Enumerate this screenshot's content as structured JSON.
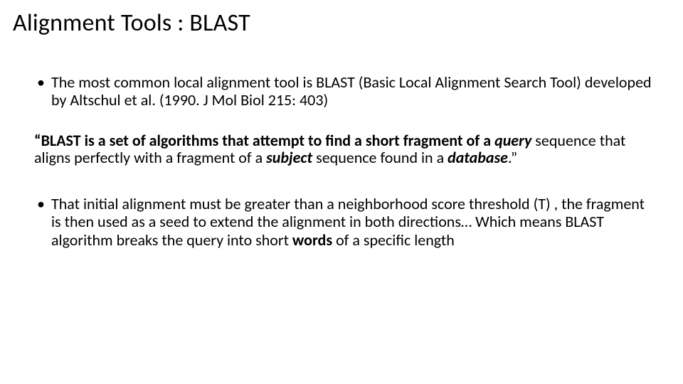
{
  "title": "Alignment Tools : BLAST",
  "p1": {
    "a": "The most common local alignment tool is BLAST (Basic Local Alignment Search Tool) developed by Altschul et al. (1990. J Mol Biol 215: 403)"
  },
  "p2": {
    "a": "“BLAST is a set of algorithms that attempt to find a short fragment of a ",
    "b": "query",
    "c": " sequence that aligns perfectly with a fragment of a ",
    "d": "subject",
    "e": " sequence found in a ",
    "f": "database",
    "g": ".”"
  },
  "p3": {
    "a": "That initial alignment must be greater than a neighborhood score threshold (T) , the fragment is then used as a seed to extend the alignment in both directions… Which means  BLAST algorithm breaks the query into short ",
    "b": "words",
    "c": " of a specific length"
  }
}
